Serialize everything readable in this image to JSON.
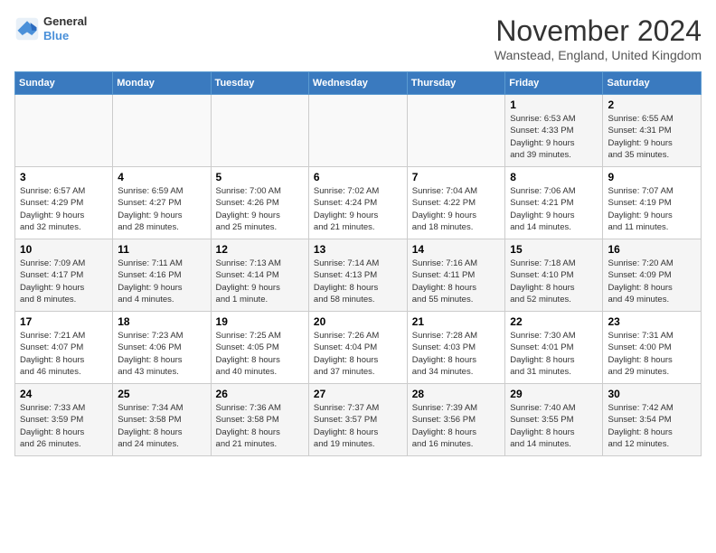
{
  "header": {
    "logo_line1": "General",
    "logo_line2": "Blue",
    "title": "November 2024",
    "subtitle": "Wanstead, England, United Kingdom"
  },
  "weekdays": [
    "Sunday",
    "Monday",
    "Tuesday",
    "Wednesday",
    "Thursday",
    "Friday",
    "Saturday"
  ],
  "weeks": [
    [
      {
        "day": "",
        "info": ""
      },
      {
        "day": "",
        "info": ""
      },
      {
        "day": "",
        "info": ""
      },
      {
        "day": "",
        "info": ""
      },
      {
        "day": "",
        "info": ""
      },
      {
        "day": "1",
        "info": "Sunrise: 6:53 AM\nSunset: 4:33 PM\nDaylight: 9 hours\nand 39 minutes."
      },
      {
        "day": "2",
        "info": "Sunrise: 6:55 AM\nSunset: 4:31 PM\nDaylight: 9 hours\nand 35 minutes."
      }
    ],
    [
      {
        "day": "3",
        "info": "Sunrise: 6:57 AM\nSunset: 4:29 PM\nDaylight: 9 hours\nand 32 minutes."
      },
      {
        "day": "4",
        "info": "Sunrise: 6:59 AM\nSunset: 4:27 PM\nDaylight: 9 hours\nand 28 minutes."
      },
      {
        "day": "5",
        "info": "Sunrise: 7:00 AM\nSunset: 4:26 PM\nDaylight: 9 hours\nand 25 minutes."
      },
      {
        "day": "6",
        "info": "Sunrise: 7:02 AM\nSunset: 4:24 PM\nDaylight: 9 hours\nand 21 minutes."
      },
      {
        "day": "7",
        "info": "Sunrise: 7:04 AM\nSunset: 4:22 PM\nDaylight: 9 hours\nand 18 minutes."
      },
      {
        "day": "8",
        "info": "Sunrise: 7:06 AM\nSunset: 4:21 PM\nDaylight: 9 hours\nand 14 minutes."
      },
      {
        "day": "9",
        "info": "Sunrise: 7:07 AM\nSunset: 4:19 PM\nDaylight: 9 hours\nand 11 minutes."
      }
    ],
    [
      {
        "day": "10",
        "info": "Sunrise: 7:09 AM\nSunset: 4:17 PM\nDaylight: 9 hours\nand 8 minutes."
      },
      {
        "day": "11",
        "info": "Sunrise: 7:11 AM\nSunset: 4:16 PM\nDaylight: 9 hours\nand 4 minutes."
      },
      {
        "day": "12",
        "info": "Sunrise: 7:13 AM\nSunset: 4:14 PM\nDaylight: 9 hours\nand 1 minute."
      },
      {
        "day": "13",
        "info": "Sunrise: 7:14 AM\nSunset: 4:13 PM\nDaylight: 8 hours\nand 58 minutes."
      },
      {
        "day": "14",
        "info": "Sunrise: 7:16 AM\nSunset: 4:11 PM\nDaylight: 8 hours\nand 55 minutes."
      },
      {
        "day": "15",
        "info": "Sunrise: 7:18 AM\nSunset: 4:10 PM\nDaylight: 8 hours\nand 52 minutes."
      },
      {
        "day": "16",
        "info": "Sunrise: 7:20 AM\nSunset: 4:09 PM\nDaylight: 8 hours\nand 49 minutes."
      }
    ],
    [
      {
        "day": "17",
        "info": "Sunrise: 7:21 AM\nSunset: 4:07 PM\nDaylight: 8 hours\nand 46 minutes."
      },
      {
        "day": "18",
        "info": "Sunrise: 7:23 AM\nSunset: 4:06 PM\nDaylight: 8 hours\nand 43 minutes."
      },
      {
        "day": "19",
        "info": "Sunrise: 7:25 AM\nSunset: 4:05 PM\nDaylight: 8 hours\nand 40 minutes."
      },
      {
        "day": "20",
        "info": "Sunrise: 7:26 AM\nSunset: 4:04 PM\nDaylight: 8 hours\nand 37 minutes."
      },
      {
        "day": "21",
        "info": "Sunrise: 7:28 AM\nSunset: 4:03 PM\nDaylight: 8 hours\nand 34 minutes."
      },
      {
        "day": "22",
        "info": "Sunrise: 7:30 AM\nSunset: 4:01 PM\nDaylight: 8 hours\nand 31 minutes."
      },
      {
        "day": "23",
        "info": "Sunrise: 7:31 AM\nSunset: 4:00 PM\nDaylight: 8 hours\nand 29 minutes."
      }
    ],
    [
      {
        "day": "24",
        "info": "Sunrise: 7:33 AM\nSunset: 3:59 PM\nDaylight: 8 hours\nand 26 minutes."
      },
      {
        "day": "25",
        "info": "Sunrise: 7:34 AM\nSunset: 3:58 PM\nDaylight: 8 hours\nand 24 minutes."
      },
      {
        "day": "26",
        "info": "Sunrise: 7:36 AM\nSunset: 3:58 PM\nDaylight: 8 hours\nand 21 minutes."
      },
      {
        "day": "27",
        "info": "Sunrise: 7:37 AM\nSunset: 3:57 PM\nDaylight: 8 hours\nand 19 minutes."
      },
      {
        "day": "28",
        "info": "Sunrise: 7:39 AM\nSunset: 3:56 PM\nDaylight: 8 hours\nand 16 minutes."
      },
      {
        "day": "29",
        "info": "Sunrise: 7:40 AM\nSunset: 3:55 PM\nDaylight: 8 hours\nand 14 minutes."
      },
      {
        "day": "30",
        "info": "Sunrise: 7:42 AM\nSunset: 3:54 PM\nDaylight: 8 hours\nand 12 minutes."
      }
    ]
  ]
}
